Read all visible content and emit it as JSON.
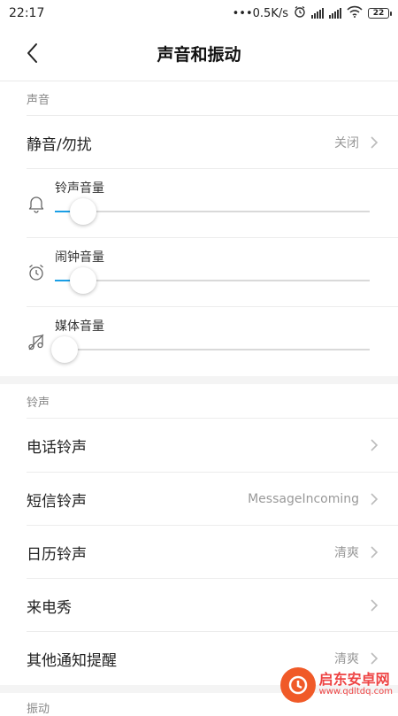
{
  "status_bar": {
    "time": "22:17",
    "network_speed": "•••0.5K/s",
    "battery": "22"
  },
  "header": {
    "title": "声音和振动"
  },
  "sections": {
    "sound": {
      "title": "声音"
    },
    "ringtone": {
      "title": "铃声"
    },
    "vibration": {
      "title": "振动"
    }
  },
  "sound": {
    "mute": {
      "label": "静音/勿扰",
      "value": "关闭"
    },
    "sliders": [
      {
        "label": "铃声音量",
        "icon": "bell-icon",
        "level": 0.09
      },
      {
        "label": "闹钟音量",
        "icon": "alarm-clock-icon",
        "level": 0.09
      },
      {
        "label": "媒体音量",
        "icon": "music-note-icon",
        "level": 0.03
      }
    ]
  },
  "ringtone": {
    "items": [
      {
        "label": "电话铃声",
        "value": ""
      },
      {
        "label": "短信铃声",
        "value": "MessageIncoming"
      },
      {
        "label": "日历铃声",
        "value": "清爽"
      },
      {
        "label": "来电秀",
        "value": ""
      },
      {
        "label": "其他通知提醒",
        "value": "清爽"
      }
    ]
  },
  "watermark": {
    "line1": "启东安卓网",
    "line2": "www.qdltdq.com"
  },
  "colors": {
    "accent": "#1a9fe6",
    "watermark": "#f05a28"
  }
}
